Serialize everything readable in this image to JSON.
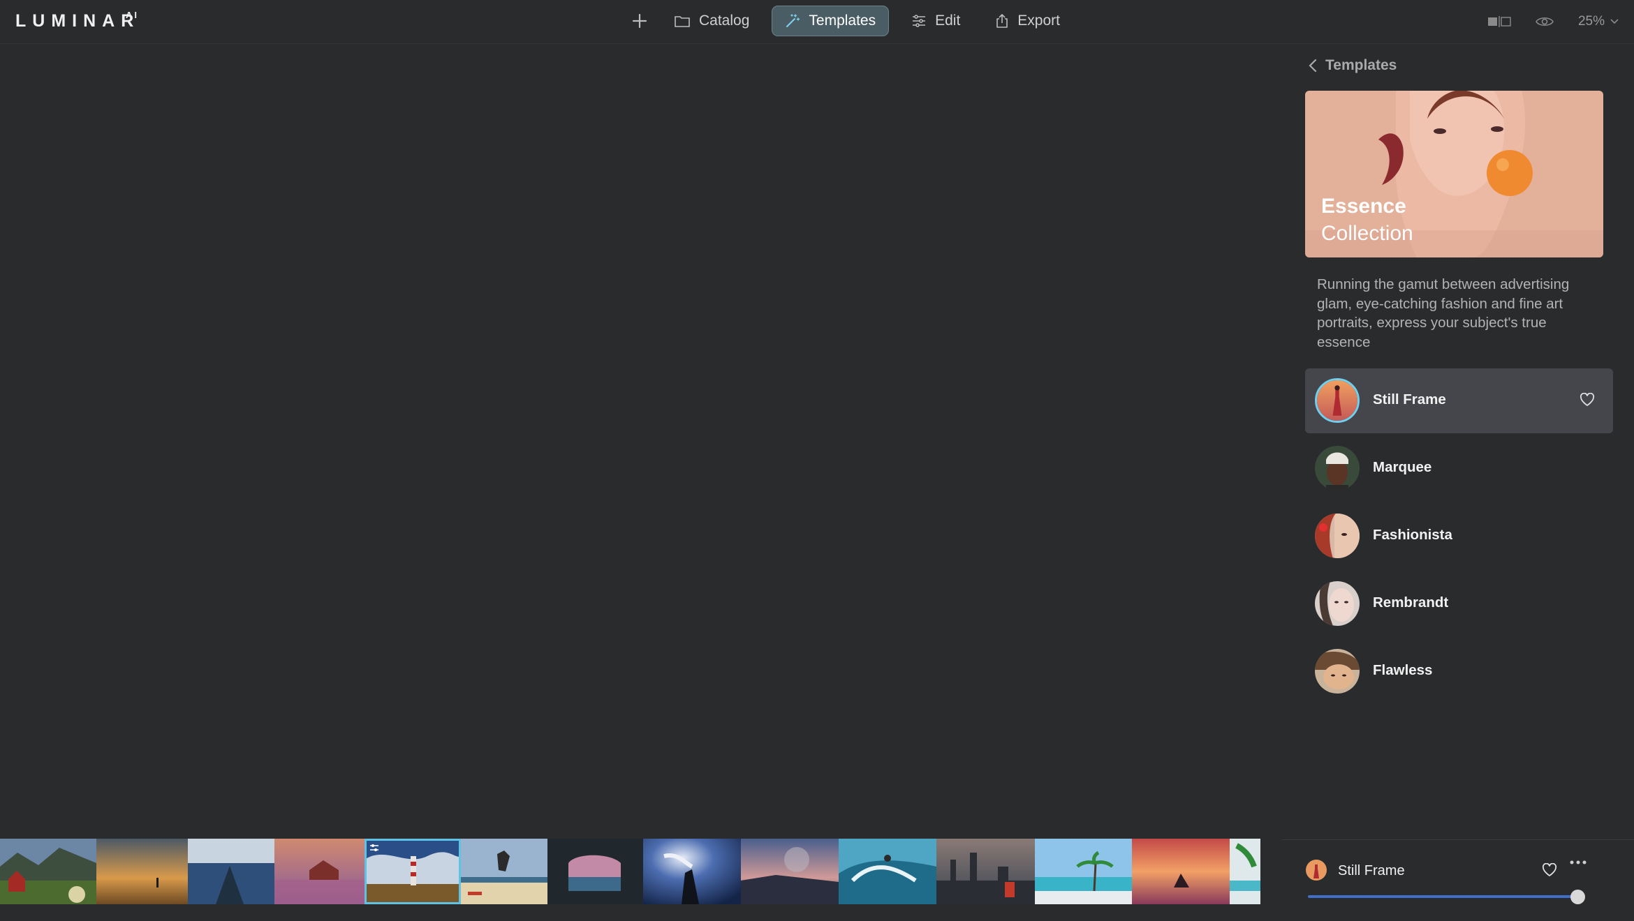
{
  "app": {
    "logo": "LUMINAR",
    "logo_sup": "AI"
  },
  "nav": {
    "add_icon": "plus-icon",
    "items": [
      {
        "label": "Catalog",
        "icon": "folder-icon"
      },
      {
        "label": "Templates",
        "icon": "magic-wand-icon",
        "active": true
      },
      {
        "label": "Edit",
        "icon": "sliders-icon"
      },
      {
        "label": "Export",
        "icon": "share-icon"
      }
    ]
  },
  "toolbar_right": {
    "compare_icon": "compare-view-icon",
    "preview_icon": "eye-icon",
    "zoom": "25%"
  },
  "panel": {
    "back_label": "Templates",
    "collection": {
      "title_bold": "Essence",
      "title": "Collection"
    },
    "description": "Running the gamut between advertising glam, eye-catching fashion and fine art portraits, express your subject's true essence",
    "templates": [
      {
        "name": "Still Frame",
        "active": true,
        "favorite_icon": "heart-outline-icon"
      },
      {
        "name": "Marquee"
      },
      {
        "name": "Fashionista"
      },
      {
        "name": "Rembrandt"
      },
      {
        "name": "Flawless"
      }
    ]
  },
  "bottom": {
    "template_name": "Still Frame",
    "amount": 100
  },
  "filmstrip": {
    "thumbnails": [
      "farm-houses",
      "sunset-person",
      "boat-lake",
      "red-cabin-lake",
      "lighthouse",
      "beach-jump",
      "cave-sunset",
      "silhouette-scarf",
      "moon-coast",
      "surfer-wave",
      "city-skyline-person",
      "palm-beach",
      "sunset-meditation",
      "palm-edge"
    ],
    "selected_index": 4
  },
  "colors": {
    "accent": "#5fc2e4",
    "active_tab": "#4a5d64",
    "slider": "#3f6fc9",
    "background": "#2a2b2d"
  }
}
